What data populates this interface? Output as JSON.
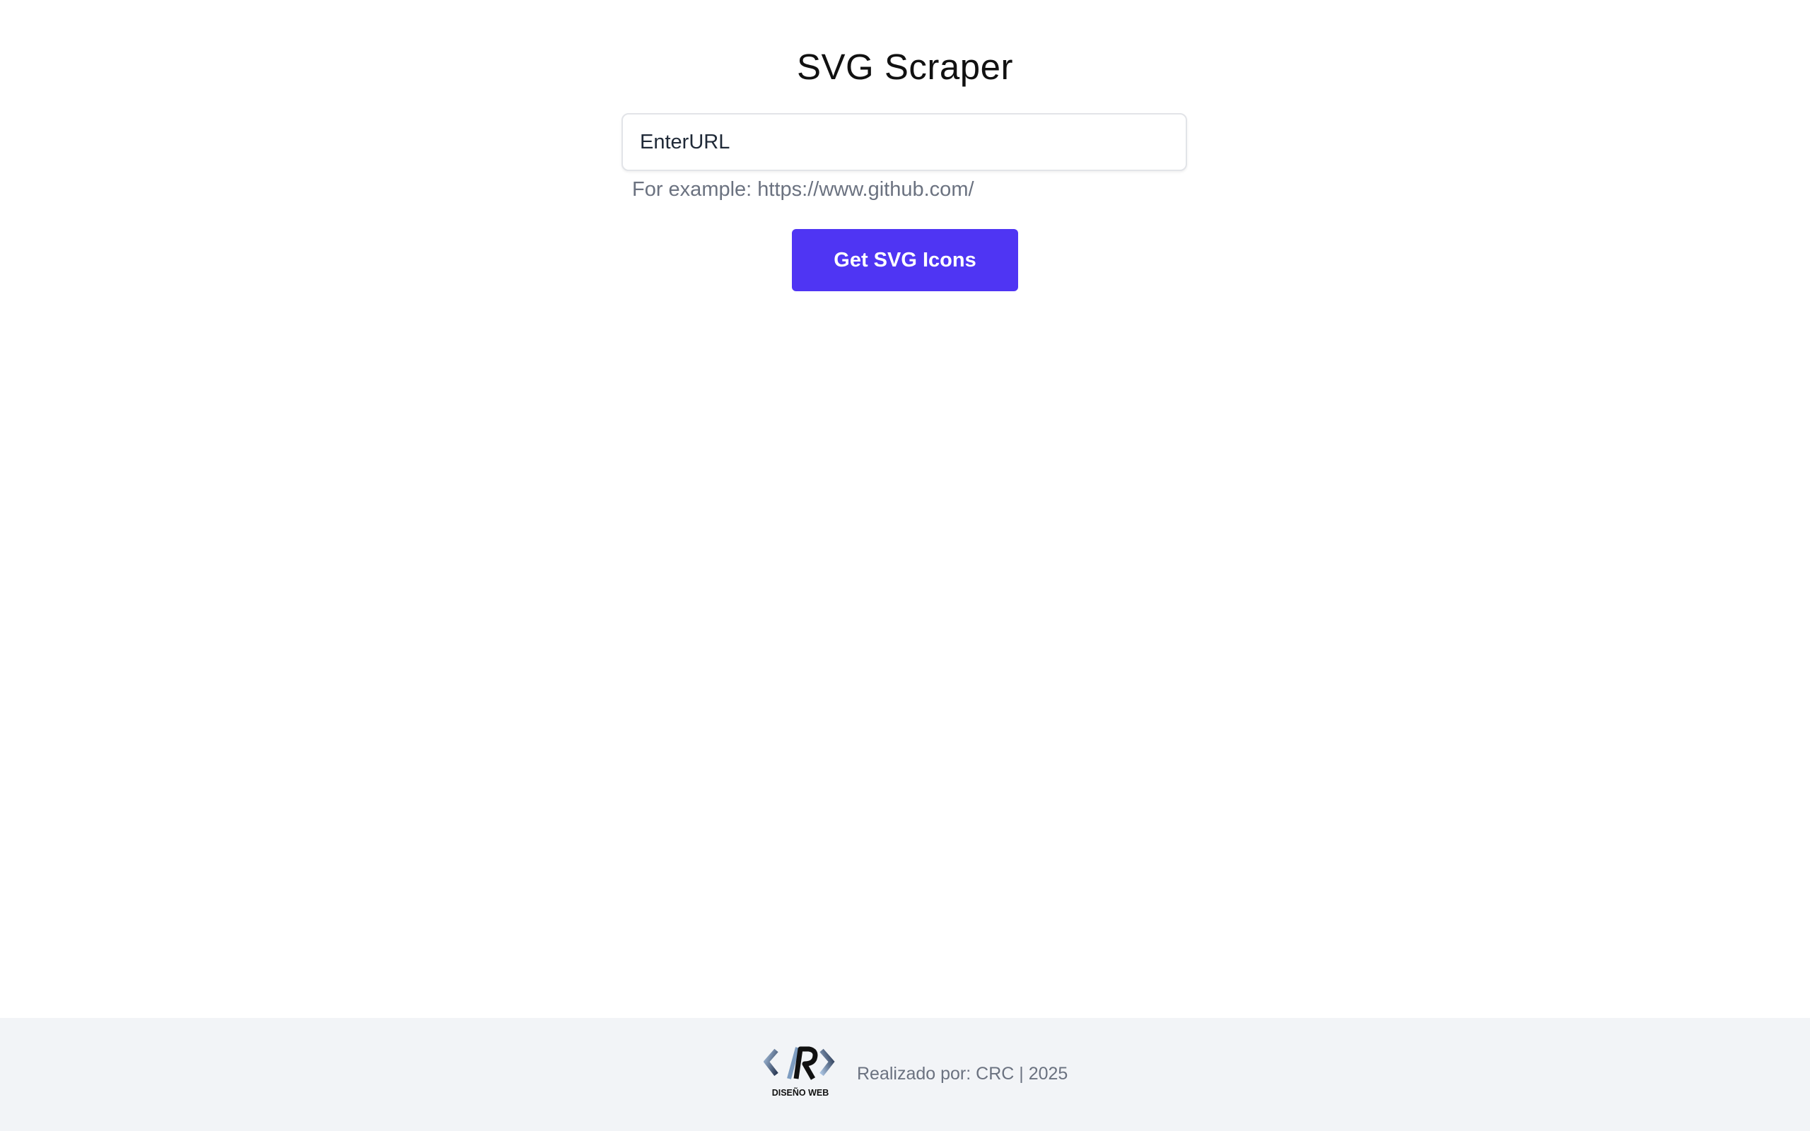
{
  "page": {
    "title": "SVG Scraper"
  },
  "form": {
    "url_placeholder": "EnterURL",
    "url_value": "",
    "hint": "For example: https://www.github.com/",
    "submit_label": "Get SVG Icons"
  },
  "footer": {
    "logo_icon": "crc-diseno-web-logo",
    "logo_text": "DISEÑO WEB",
    "credit": "Realizado por: CRC | 2025"
  },
  "colors": {
    "accent": "#4f35f3",
    "footer_bg": "#f2f4f7",
    "muted_text": "#6b7280"
  }
}
